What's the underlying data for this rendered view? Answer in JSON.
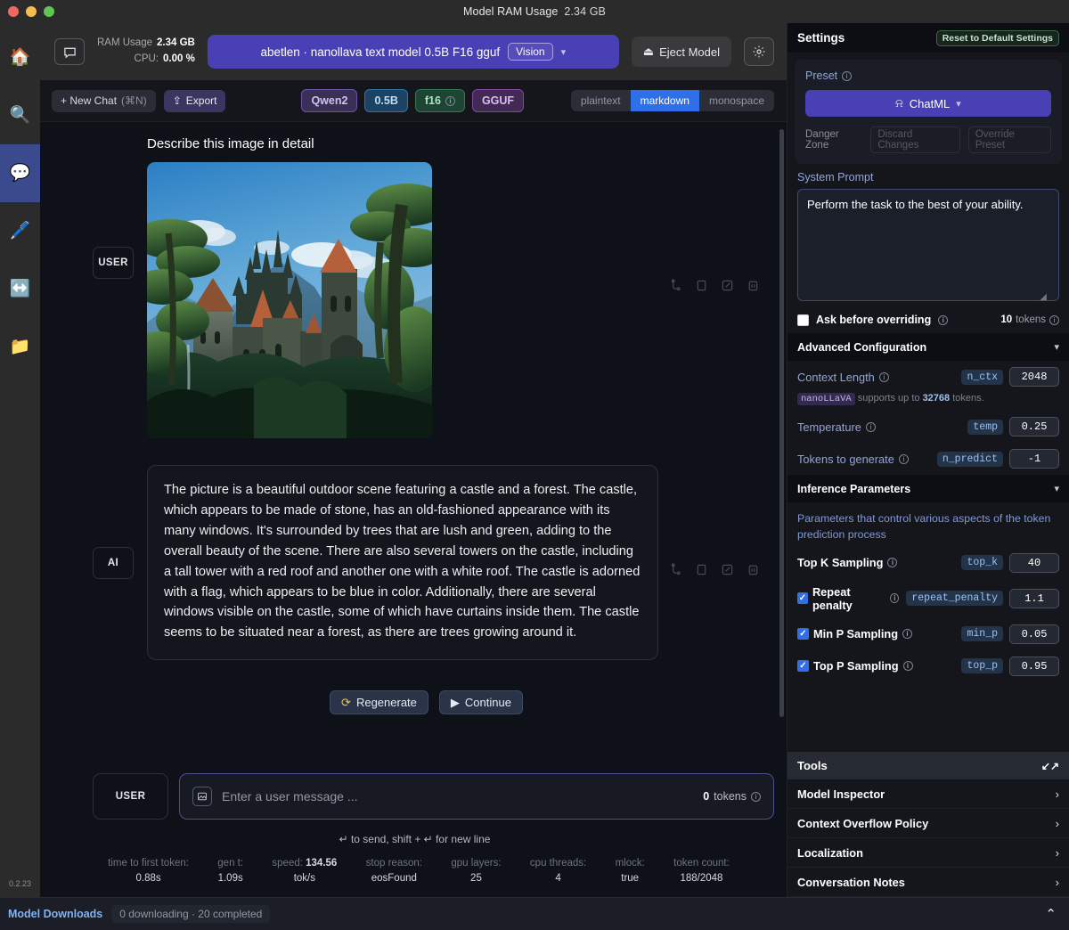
{
  "window": {
    "title_label": "Model RAM Usage",
    "title_value": "2.34 GB"
  },
  "rail": {
    "items": [
      {
        "name": "home",
        "glyph": "🏠",
        "active": false
      },
      {
        "name": "search",
        "glyph": "🔍",
        "active": false
      },
      {
        "name": "chat",
        "glyph": "💬",
        "active": true
      },
      {
        "name": "playground",
        "glyph": "🖊️",
        "active": false
      },
      {
        "name": "server",
        "glyph": "↔️",
        "active": false
      },
      {
        "name": "folder",
        "glyph": "📁",
        "active": false
      }
    ],
    "version": "0.2.23"
  },
  "topbar": {
    "ram_label": "RAM Usage",
    "ram_value": "2.34 GB",
    "cpu_label": "CPU:",
    "cpu_value": "0.00 %",
    "model_name": "abetlen · nanollava text model 0.5B F16 gguf",
    "vision_badge": "Vision",
    "eject_label": "Eject Model"
  },
  "toolbar": {
    "new_chat_label": "+ New Chat",
    "new_chat_shortcut": "(⌘N)",
    "export_label": "Export",
    "tags": [
      {
        "label": "Qwen2",
        "kind": "arch"
      },
      {
        "label": "0.5B",
        "kind": "params"
      },
      {
        "label": "f16",
        "kind": "quant"
      },
      {
        "label": "GGUF",
        "kind": "fmt"
      }
    ],
    "view_modes": [
      {
        "label": "plaintext",
        "active": false
      },
      {
        "label": "markdown",
        "active": true
      },
      {
        "label": "monospace",
        "active": false
      }
    ]
  },
  "conversation": {
    "user": {
      "role": "USER",
      "text": "Describe this image in detail",
      "image_alt": "fantasy castle in a forest"
    },
    "assistant": {
      "role": "AI",
      "text": "The picture is a beautiful outdoor scene featuring a castle and a forest. The castle, which appears to be made of stone, has an old-fashioned appearance with its many windows. It's surrounded by trees that are lush and green, adding to the overall beauty of the scene. There are also several towers on the castle, including a tall tower with a red roof and another one with a white roof. The castle is adorned with a flag, which appears to be blue in color. Additionally, there are several windows visible on the castle, some of which have curtains inside them. The castle seems to be situated near a forest, as there are trees growing around it."
    },
    "actions": [
      "branch-icon",
      "copy-icon",
      "edit-icon",
      "delete-icon"
    ],
    "regenerate_label": "Regenerate",
    "continue_label": "Continue"
  },
  "composer": {
    "role": "USER",
    "placeholder": "Enter a user message ...",
    "token_count": "0",
    "token_label": "tokens",
    "hint": "↵ to send, shift + ↵ for new line"
  },
  "stats": [
    {
      "key": "time to first token:",
      "value": "0.88s"
    },
    {
      "key": "gen t:",
      "value": "1.09s"
    },
    {
      "key": "speed:",
      "inline": "134.56",
      "value": "tok/s"
    },
    {
      "key": "stop reason:",
      "value": "eosFound"
    },
    {
      "key": "gpu layers:",
      "value": "25"
    },
    {
      "key": "cpu threads:",
      "value": "4"
    },
    {
      "key": "mlock:",
      "value": "true"
    },
    {
      "key": "token count:",
      "value": "188/2048"
    }
  ],
  "settings": {
    "title": "Settings",
    "reset_label": "Reset to Default Settings",
    "preset": {
      "label": "Preset",
      "value": "ChatML",
      "danger_zone_label": "Danger Zone",
      "discard_label": "Discard Changes",
      "override_label": "Override Preset"
    },
    "system_prompt": {
      "label": "System Prompt",
      "value": "Perform the task to the best of your ability.",
      "ask_before_overriding": "Ask before overriding",
      "ask_checked": false,
      "token_count": "10",
      "token_label": "tokens"
    },
    "advanced": {
      "title": "Advanced Configuration",
      "rows": [
        {
          "label": "Context Length",
          "code": "n_ctx",
          "value": "2048"
        },
        {
          "label": "Temperature",
          "code": "temp",
          "value": "0.25"
        },
        {
          "label": "Tokens to generate",
          "code": "n_predict",
          "value": "-1"
        }
      ],
      "supports_model": "nanoLLaVA",
      "supports_text_a": "supports up to",
      "supports_tokens": "32768",
      "supports_text_b": "tokens."
    },
    "inference": {
      "title": "Inference Parameters",
      "description": "Parameters that control various aspects of the token prediction process",
      "rows": [
        {
          "label": "Top K Sampling",
          "code": "top_k",
          "value": "40",
          "checkbox": false
        },
        {
          "label": "Repeat penalty",
          "code": "repeat_penalty",
          "value": "1.1",
          "checkbox": true,
          "checked": true
        },
        {
          "label": "Min P Sampling",
          "code": "min_p",
          "value": "0.05",
          "checkbox": true,
          "checked": true
        },
        {
          "label": "Top P Sampling",
          "code": "top_p",
          "value": "0.95",
          "checkbox": true,
          "checked": true
        }
      ]
    },
    "tools": {
      "title": "Tools",
      "items": [
        {
          "label": "Model Inspector"
        },
        {
          "label": "Context Overflow Policy"
        },
        {
          "label": "Localization"
        },
        {
          "label": "Conversation Notes"
        }
      ]
    }
  },
  "downloads": {
    "title": "Model Downloads",
    "status": "0 downloading · 20 completed"
  },
  "colors": {
    "accent_purple": "#4a40b5",
    "accent_blue": "#2f6fea",
    "panel_bg": "#14161c",
    "chat_bg": "#0e1117",
    "chrome": "#2b2b2b"
  }
}
